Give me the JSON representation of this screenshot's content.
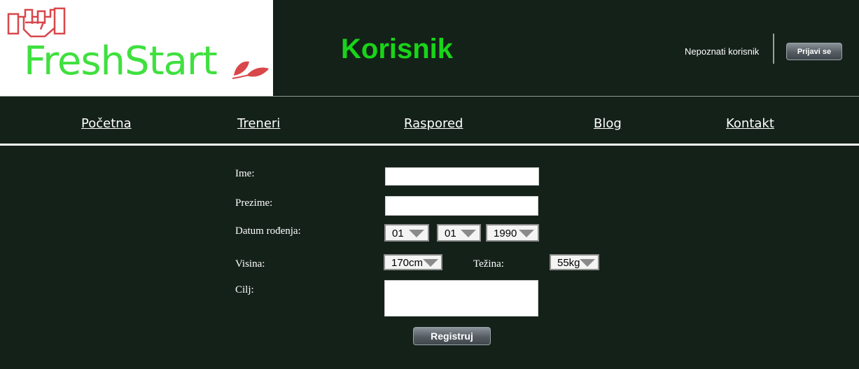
{
  "header": {
    "logo_text": "FreshStart",
    "page_title": "Korisnik",
    "user_label": "Nepoznati korisnik",
    "login_label": "Prijavi se"
  },
  "nav": {
    "items": [
      {
        "label": "Početna"
      },
      {
        "label": "Treneri"
      },
      {
        "label": "Raspored"
      },
      {
        "label": "Blog"
      },
      {
        "label": "Kontakt"
      }
    ]
  },
  "form": {
    "first_name_label": "Ime:",
    "first_name_value": "",
    "last_name_label": "Prezime:",
    "last_name_value": "",
    "birthdate_label": "Datum rođenja:",
    "birth_day": "01",
    "birth_month": "01",
    "birth_year": "1990",
    "height_label": "Visina:",
    "height_value": "170cm",
    "weight_label": "Težina:",
    "weight_value": "55kg",
    "goal_label": "Cilj:",
    "goal_value": "",
    "submit_label": "Registruj"
  },
  "colors": {
    "background": "#142119",
    "logo_green": "#3fe03f",
    "logo_red": "#d8474a",
    "title_green": "#19d419"
  }
}
